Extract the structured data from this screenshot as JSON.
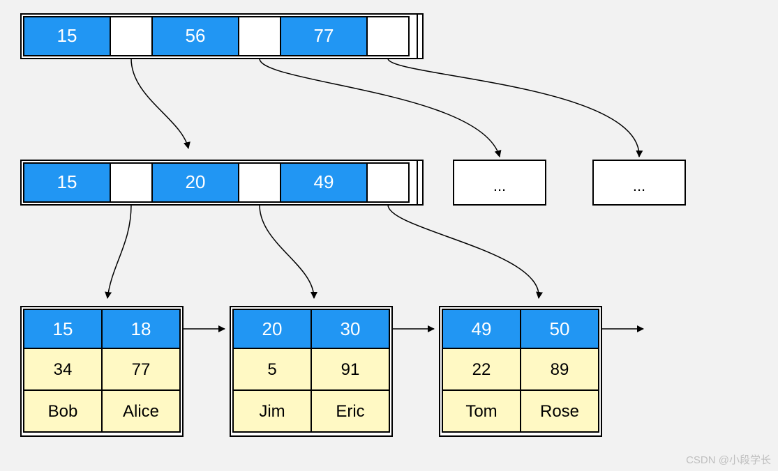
{
  "colors": {
    "blue": "#2196f3",
    "yellow": "#fff9c4",
    "border": "#000000",
    "bg": "#f2f2f2"
  },
  "root": {
    "keys": [
      "15",
      "56",
      "77"
    ]
  },
  "internal": {
    "keys": [
      "15",
      "20",
      "49"
    ]
  },
  "placeholders": [
    "...",
    "..."
  ],
  "leaves": [
    {
      "keys": [
        "15",
        "18"
      ],
      "row1": [
        "34",
        "77"
      ],
      "row2": [
        "Bob",
        "Alice"
      ]
    },
    {
      "keys": [
        "20",
        "30"
      ],
      "row1": [
        "5",
        "91"
      ],
      "row2": [
        "Jim",
        "Eric"
      ]
    },
    {
      "keys": [
        "49",
        "50"
      ],
      "row1": [
        "22",
        "89"
      ],
      "row2": [
        "Tom",
        "Rose"
      ]
    }
  ],
  "watermark": "CSDN @小段学长"
}
